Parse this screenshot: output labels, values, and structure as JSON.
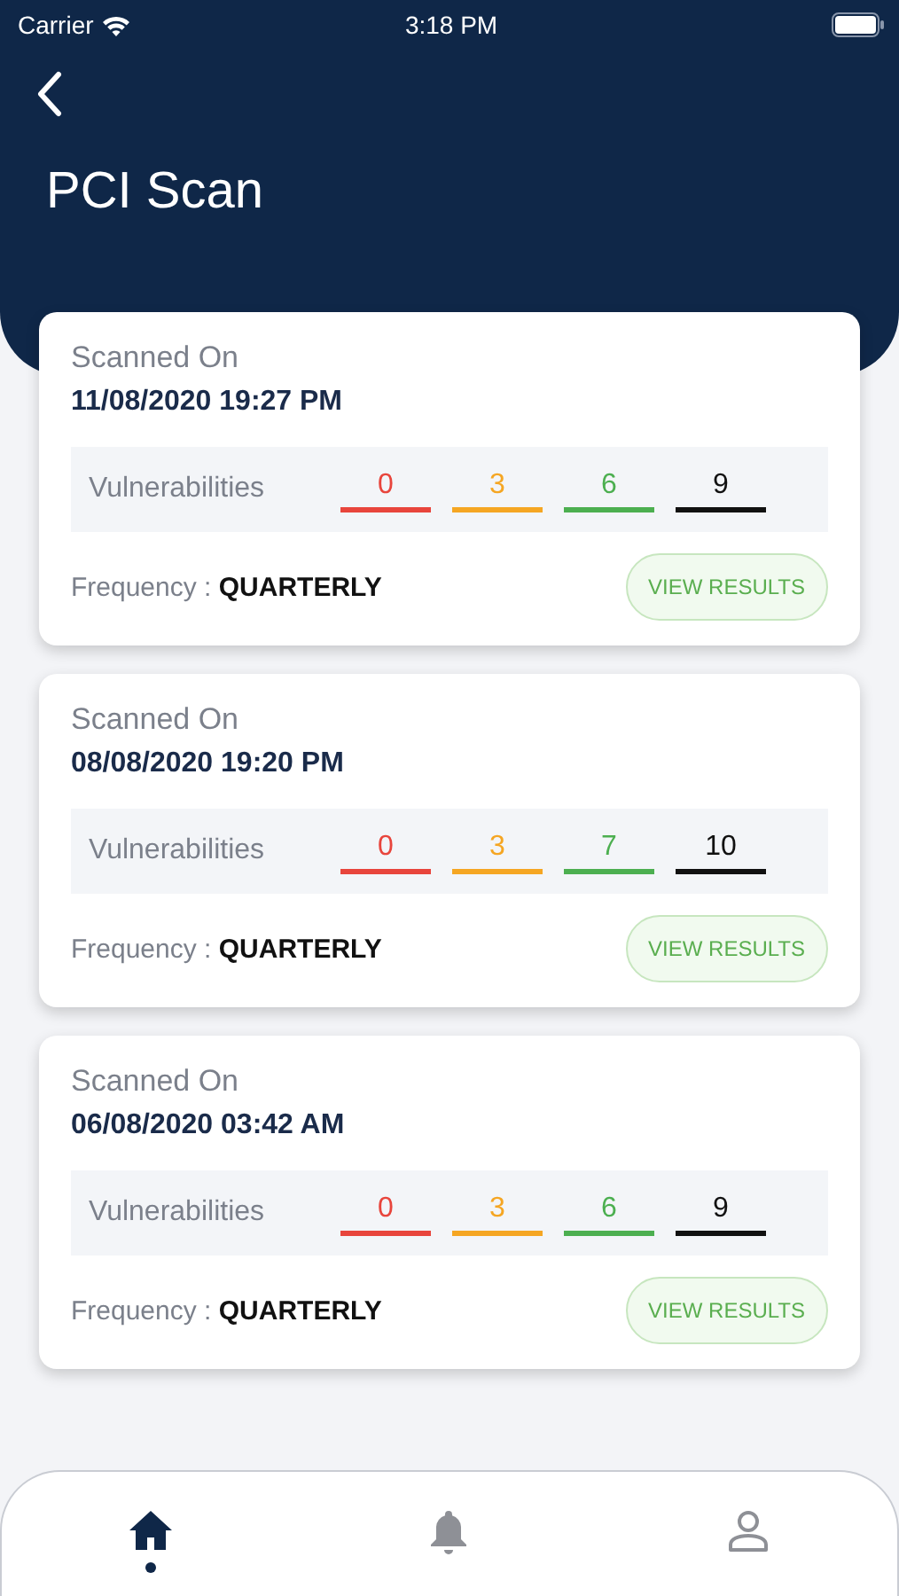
{
  "status_bar": {
    "carrier": "Carrier",
    "time": "3:18 PM"
  },
  "header": {
    "title": "PCI Scan"
  },
  "scans": [
    {
      "label": "Scanned On",
      "date": "11/08/2020 19:27 PM",
      "vulnerabilities_label": "Vulnerabilities",
      "counts": [
        {
          "value": "0",
          "color": "#e8453c"
        },
        {
          "value": "3",
          "color": "#f5a623"
        },
        {
          "value": "6",
          "color": "#4caf50"
        },
        {
          "value": "9",
          "color": "#111111"
        }
      ],
      "frequency_label": "Frequency :",
      "frequency": "QUARTERLY",
      "button": "VIEW RESULTS"
    },
    {
      "label": "Scanned On",
      "date": "08/08/2020 19:20 PM",
      "vulnerabilities_label": "Vulnerabilities",
      "counts": [
        {
          "value": "0",
          "color": "#e8453c"
        },
        {
          "value": "3",
          "color": "#f5a623"
        },
        {
          "value": "7",
          "color": "#4caf50"
        },
        {
          "value": "10",
          "color": "#111111"
        }
      ],
      "frequency_label": "Frequency :",
      "frequency": "QUARTERLY",
      "button": "VIEW RESULTS"
    },
    {
      "label": "Scanned On",
      "date": "06/08/2020 03:42 AM",
      "vulnerabilities_label": "Vulnerabilities",
      "counts": [
        {
          "value": "0",
          "color": "#e8453c"
        },
        {
          "value": "3",
          "color": "#f5a623"
        },
        {
          "value": "6",
          "color": "#4caf50"
        },
        {
          "value": "9",
          "color": "#111111"
        }
      ],
      "frequency_label": "Frequency :",
      "frequency": "QUARTERLY",
      "button": "VIEW RESULTS"
    }
  ],
  "nav": [
    {
      "kind": "home",
      "selected": true
    },
    {
      "kind": "bell",
      "selected": false
    },
    {
      "kind": "profile",
      "selected": false
    }
  ]
}
